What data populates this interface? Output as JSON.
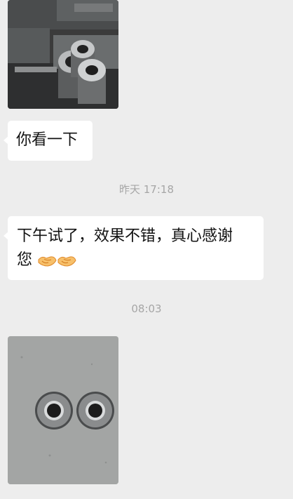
{
  "chat": {
    "messages": [
      {
        "type": "image",
        "alt_icon": "photo-icon"
      },
      {
        "type": "text",
        "text": "你看一下"
      },
      {
        "type": "timestamp",
        "text": "昨天 17:18"
      },
      {
        "type": "text",
        "text": "下午试了，效果不错，真心感谢您",
        "line1": "下午试了，效果不错，真心感谢",
        "line2": "您",
        "emoji": [
          "handshake-icon",
          "handshake-icon"
        ]
      },
      {
        "type": "timestamp",
        "text": "08:03"
      },
      {
        "type": "image",
        "alt_icon": "photo-icon"
      }
    ]
  },
  "colors": {
    "background": "#ededed",
    "bubble": "#ffffff",
    "timestamp": "#a6a6a6",
    "text": "#111111"
  }
}
